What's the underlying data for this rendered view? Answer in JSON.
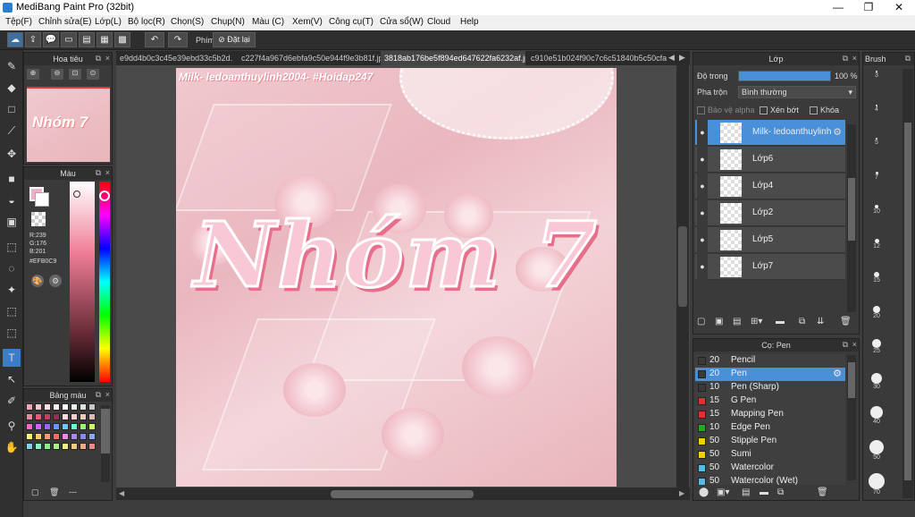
{
  "app": {
    "title": "MediBang Paint Pro (32bit)"
  },
  "window_controls": {
    "minimize": "—",
    "maximize": "❐",
    "close": "✕"
  },
  "menu": [
    "Tệp(F)",
    "Chỉnh sửa(E)",
    "Lớp(L)",
    "Bộ lọc(R)",
    "Chọn(S)",
    "Chụp(N)",
    "Màu (C)",
    "Xem(V)",
    "Công cụ(T)",
    "Cửa sổ(W)",
    "Cloud",
    "Help"
  ],
  "toolbar": {
    "shortcut_label": "Phím",
    "reset_label": "Đặt lại"
  },
  "navigator": {
    "title": "Hoa tiêu"
  },
  "color": {
    "title": "Màu",
    "r": "R:239",
    "g": "G:176",
    "b": "B:201",
    "hex": "#EFB0C9",
    "primary": "#EFB0C9"
  },
  "palette": {
    "title": "Bảng màu",
    "footer": "---"
  },
  "tabs": [
    "e9dd4b0c3c45e39ebd33c5b2d.jpg",
    "c227f4a967d6ebfa9c50e944f9e3b81f.jpg",
    "3818ab176be5f894ed647622fa6232af.jpg",
    "c910e51b024f90c7c6c51840b5c50cfa.jpg"
  ],
  "canvas": {
    "watermark": "Milk- ledoanthuylinh2004- #Hoidap247",
    "art_text": "Nhóm 7"
  },
  "layers": {
    "title": "Lớp",
    "opacity_label": "Độ trong",
    "opacity_value": "100 %",
    "opacity_fraction": 1.0,
    "blend_label": "Pha trộn",
    "blend_value": "Bình thường",
    "protect_alpha": "Bảo vệ alpha",
    "clipping": "Xén bớt",
    "lock": "Khóa",
    "items": [
      {
        "name": "Milk- ledoanthuylinh"
      },
      {
        "name": "Lớp6"
      },
      {
        "name": "Lớp4"
      },
      {
        "name": "Lớp2"
      },
      {
        "name": "Lớp5"
      },
      {
        "name": "Lớp7"
      }
    ]
  },
  "brushes": {
    "title": "Cọ: Pen",
    "items": [
      {
        "size": "20",
        "name": "Pencil",
        "color": "#3a3a3a"
      },
      {
        "size": "20",
        "name": "Pen",
        "color": "#3a3a3a"
      },
      {
        "size": "10",
        "name": "Pen (Sharp)",
        "color": "#3a3a3a"
      },
      {
        "size": "15",
        "name": "G Pen",
        "color": "#e03030"
      },
      {
        "size": "15",
        "name": "Mapping Pen",
        "color": "#e03030"
      },
      {
        "size": "10",
        "name": "Edge Pen",
        "color": "#22aa22"
      },
      {
        "size": "50",
        "name": "Stipple Pen",
        "color": "#f0d000"
      },
      {
        "size": "50",
        "name": "Sumi",
        "color": "#f0d000"
      },
      {
        "size": "50",
        "name": "Watercolor",
        "color": "#59b9e8"
      },
      {
        "size": "50",
        "name": "Watercolor (Wet)",
        "color": "#59b9e8"
      }
    ]
  },
  "brush_size": {
    "title": "Brush",
    "sizes": [
      "3",
      "4",
      "5",
      "7",
      "10",
      "12",
      "15",
      "20",
      "25",
      "30",
      "40",
      "50",
      "70"
    ]
  }
}
